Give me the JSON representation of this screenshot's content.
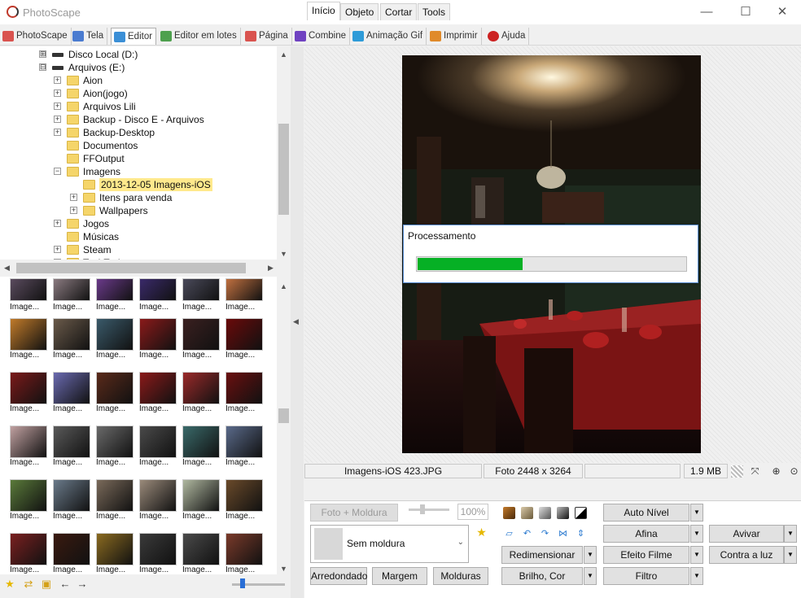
{
  "window": {
    "title": "PhotoScape",
    "minimize": "—",
    "maximize": "☐",
    "close": "✕"
  },
  "menu": {
    "tabs": [
      {
        "label": "PhotoScape",
        "color": "#d9534f"
      },
      {
        "label": "Tela",
        "color": "#4a7bd0"
      },
      {
        "label": "Editor",
        "color": "#3b8fd6"
      },
      {
        "label": "Editor em lotes",
        "color": "#4ea04e"
      },
      {
        "label": "Página",
        "color": "#d9534f"
      },
      {
        "label": "Combine",
        "color": "#6f42c1"
      },
      {
        "label": "Animação Gif",
        "color": "#2e9bd8"
      },
      {
        "label": "Imprimir",
        "color": "#e08a2a"
      },
      {
        "label": "Ajuda",
        "color": "#cc2222"
      }
    ]
  },
  "tree": {
    "nodes": [
      {
        "label": "Disco Local (D:)",
        "exp": "⊞",
        "type": "drive",
        "indent": 0
      },
      {
        "label": "Arquivos (E:)",
        "exp": "⊟",
        "type": "drive",
        "indent": 0
      },
      {
        "label": "Aion",
        "exp": "+",
        "type": "folder",
        "indent": 1
      },
      {
        "label": "Aion(jogo)",
        "exp": "+",
        "type": "folder",
        "indent": 1
      },
      {
        "label": "Arquivos Lili",
        "exp": "+",
        "type": "folder",
        "indent": 1
      },
      {
        "label": "Backup - Disco E - Arquivos",
        "exp": "+",
        "type": "folder",
        "indent": 1
      },
      {
        "label": "Backup-Desktop",
        "exp": "+",
        "type": "folder",
        "indent": 1
      },
      {
        "label": "Documentos",
        "exp": "",
        "type": "folder",
        "indent": 1
      },
      {
        "label": "FFOutput",
        "exp": "",
        "type": "folder",
        "indent": 1
      },
      {
        "label": "Imagens",
        "exp": "−",
        "type": "folder",
        "indent": 1
      },
      {
        "label": "2013-12-05 Imagens-iOS",
        "exp": "",
        "type": "folder",
        "indent": 2,
        "selected": true
      },
      {
        "label": "Itens para venda",
        "exp": "+",
        "type": "folder",
        "indent": 2
      },
      {
        "label": "Wallpapers",
        "exp": "+",
        "type": "folder",
        "indent": 2
      },
      {
        "label": "Jogos",
        "exp": "+",
        "type": "folder",
        "indent": 1
      },
      {
        "label": "Músicas",
        "exp": "",
        "type": "folder",
        "indent": 1
      },
      {
        "label": "Steam",
        "exp": "+",
        "type": "folder",
        "indent": 1
      },
      {
        "label": "TechTudo",
        "exp": "+",
        "type": "folder",
        "indent": 1
      }
    ]
  },
  "thumbnails": {
    "caption": "Image...",
    "colors": [
      "#5a4b5e",
      "#8a7a80",
      "#6a3a8a",
      "#3a2a6a",
      "#4a4a5a",
      "#c07040",
      "#c07a2a",
      "#6a5a4a",
      "#3a5a6a",
      "#8a1a1a",
      "#3a2020",
      "#6a0a0a",
      "#7a1a1a",
      "#6a6ab0",
      "#5a2a1a",
      "#8a1a1a",
      "#9a2a2a",
      "#6a1010",
      "#c0a0a0",
      "#5a5a5a",
      "#6a6a6a",
      "#4a4a4a",
      "#3a6a6a",
      "#5a6a8a",
      "#5a7a3a",
      "#6a7a8a",
      "#7a6a5a",
      "#9a8a7a",
      "#b0b8a0",
      "#6a4a2a",
      "#7a2020",
      "#3a1a10",
      "#8a6a20",
      "#3a3a3a",
      "#4a4a4a",
      "#7a3a2a"
    ]
  },
  "canvas": {
    "dialog_title": "Processamento",
    "progress": 0.39
  },
  "statusbar": {
    "filename": "Imagens-iOS 423.JPG",
    "dimensions": "Foto 2448 x 3264",
    "empty": "",
    "filesize": "1.9 MB"
  },
  "panel": {
    "tabs": [
      "Início",
      "Objeto",
      "Cortar",
      "Tools"
    ],
    "photo_frame_btn": "Foto + Moldura",
    "opacity": "100%",
    "frame_select": "Sem moldura",
    "round_btn": "Arredondado",
    "margin_btn": "Margem",
    "frames_btn": "Molduras",
    "resize_btn": "Redimensionar",
    "brightness_btn": "Brilho, Cor",
    "auto_level_btn": "Auto Nível",
    "sharpen_btn": "Afina",
    "film_btn": "Efeito Filme",
    "filter_btn": "Filtro",
    "vivid_btn": "Avivar",
    "backlight_btn": "Contra a luz"
  },
  "icons": {
    "dropdown": "▼",
    "star": "★",
    "up": "▲",
    "down": "▼",
    "left": "◀",
    "right": "▶"
  }
}
